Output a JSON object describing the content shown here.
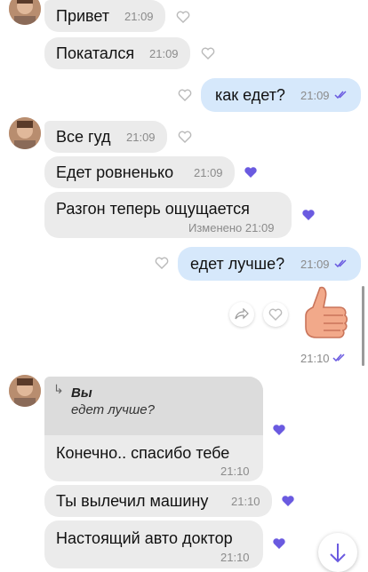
{
  "colors": {
    "incoming_bubble": "#ebebeb",
    "outgoing_bubble": "#d6e8fb",
    "liked_heart": "#6a5ae0",
    "empty_heart": "#b9b9b9",
    "read_ticks": "#6a5ae0"
  },
  "messages": [
    {
      "id": "m1",
      "text": "Привет",
      "time": "21:09",
      "liked": false
    },
    {
      "id": "m2",
      "text": "Покатался",
      "time": "21:09",
      "liked": false
    },
    {
      "id": "m3",
      "text": "как едет?",
      "time": "21:09",
      "liked": false,
      "outgoing": true
    },
    {
      "id": "m4",
      "text": "Все гуд",
      "time": "21:09",
      "liked": false
    },
    {
      "id": "m5",
      "text": "Едет ровненько",
      "time": "21:09",
      "liked": true
    },
    {
      "id": "m6",
      "text": "Разгон теперь ощущается",
      "time": "Изменено 21:09",
      "liked": true
    },
    {
      "id": "m7",
      "text": "едет лучше?",
      "time": "21:09",
      "liked": false,
      "outgoing": true
    },
    {
      "id": "m8",
      "sticker": "thumbs-up",
      "time": "21:10",
      "outgoing": true
    },
    {
      "id": "m9",
      "reply_author": "Вы",
      "reply_text": "едет лучше?",
      "text": "Конечно.. спасибо тебе",
      "time": "21:10",
      "liked": true
    },
    {
      "id": "m10",
      "text": "Ты вылечил машину",
      "time": "21:10",
      "liked": true
    },
    {
      "id": "m11",
      "text": "Настоящий авто доктор",
      "time": "21:10",
      "liked": true
    }
  ]
}
